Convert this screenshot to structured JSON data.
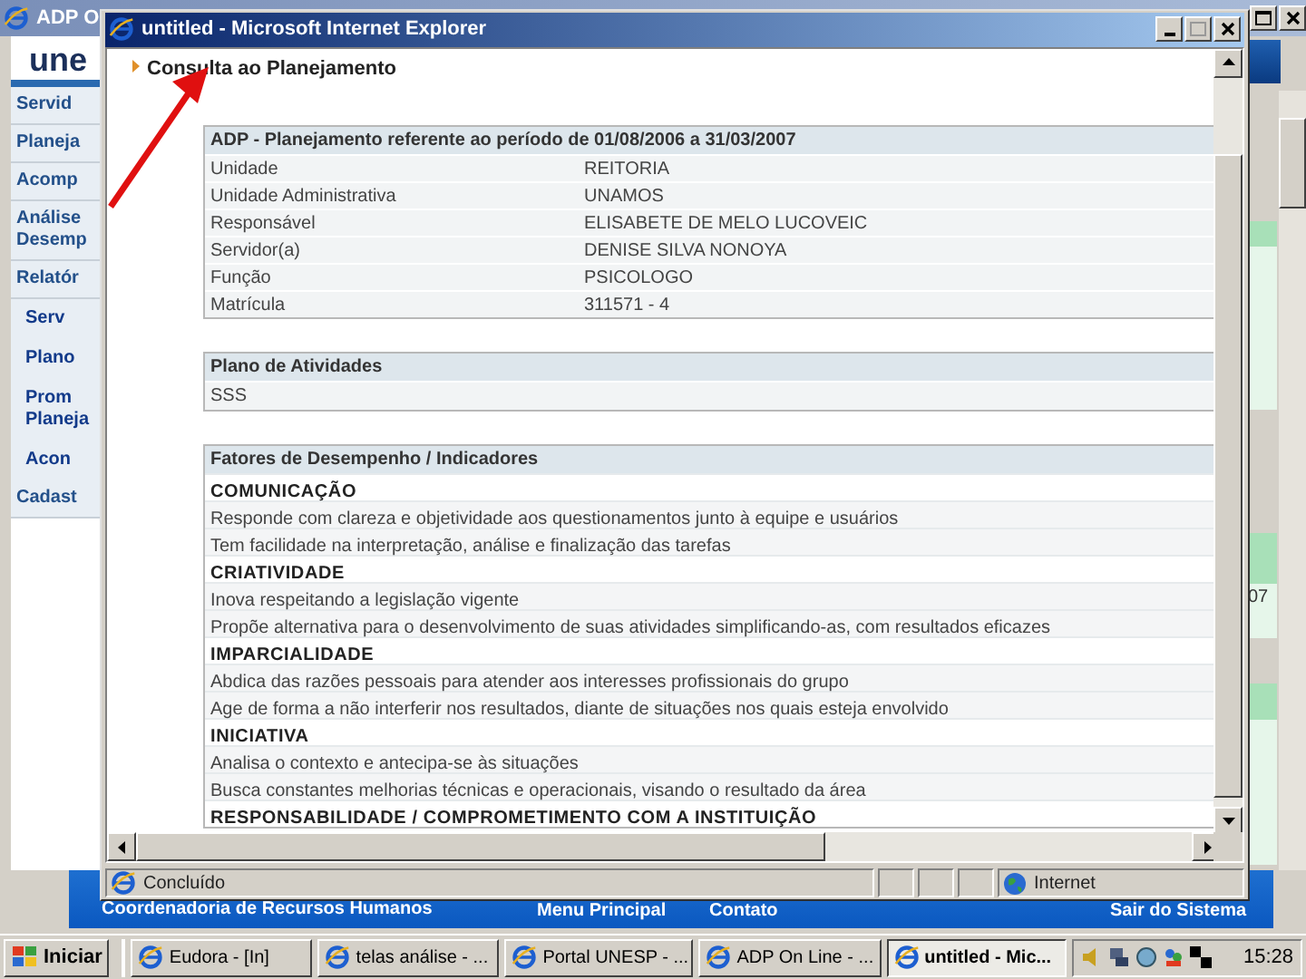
{
  "background_window": {
    "title": "ADP O",
    "logo": "une",
    "menu": [
      {
        "kind": "section",
        "label": "Servid"
      },
      {
        "kind": "section",
        "label": "Planeja"
      },
      {
        "kind": "section",
        "label": "Acomp"
      },
      {
        "kind": "section",
        "label": "Análise Desemp"
      },
      {
        "kind": "section",
        "label": "Relatór"
      },
      {
        "kind": "sub",
        "label": "Serv"
      },
      {
        "kind": "sub",
        "label": "Plano"
      },
      {
        "kind": "sub",
        "label": "Prom Planeja"
      },
      {
        "kind": "sub",
        "label": "Acon"
      },
      {
        "kind": "section",
        "label": "Cadast"
      }
    ],
    "right_fragment": "07",
    "footer": {
      "title": "Coordenadoria de Recursos Humanos",
      "links": [
        "Menu Principal",
        "Contato",
        "Sair do Sistema"
      ]
    }
  },
  "popup_window": {
    "title": "untitled - Microsoft Internet Explorer",
    "heading": "Consulta ao Planejamento",
    "info_table": {
      "header": "ADP - Planejamento referente ao período de 01/08/2006 a 31/03/2007",
      "rows": [
        [
          "Unidade",
          "REITORIA"
        ],
        [
          "Unidade Administrativa",
          "UNAMOS"
        ],
        [
          "Responsável",
          "ELISABETE DE MELO LUCOVEIC"
        ],
        [
          "Servidor(a)",
          "DENISE SILVA NONOYA"
        ],
        [
          "Função",
          "PSICOLOGO"
        ],
        [
          "Matrícula",
          "311571 - 4"
        ]
      ]
    },
    "activities_table": {
      "header": "Plano de Atividades",
      "rows": [
        "SSS"
      ]
    },
    "factors_table": {
      "header": "Fatores de Desempenho / Indicadores",
      "rows": [
        {
          "kind": "group",
          "text": "COMUNICAÇÃO"
        },
        {
          "kind": "item",
          "text": "Responde com clareza e objetividade aos questionamentos junto à equipe e usuários"
        },
        {
          "kind": "item",
          "text": "Tem facilidade na interpretação, análise e finalização das tarefas"
        },
        {
          "kind": "group",
          "text": "CRIATIVIDADE"
        },
        {
          "kind": "item",
          "text": "Inova respeitando a legislação vigente"
        },
        {
          "kind": "item",
          "text": "Propõe alternativa para o desenvolvimento de suas atividades simplificando-as, com resultados eficazes"
        },
        {
          "kind": "group",
          "text": "IMPARCIALIDADE"
        },
        {
          "kind": "item",
          "text": "Abdica das razões pessoais para atender aos interesses profissionais do grupo"
        },
        {
          "kind": "item",
          "text": "Age de forma a não interferir nos resultados, diante de situações nos quais esteja envolvido"
        },
        {
          "kind": "group",
          "text": "INICIATIVA"
        },
        {
          "kind": "item",
          "text": "Analisa o contexto e antecipa-se às situações"
        },
        {
          "kind": "item",
          "text": "Busca constantes melhorias técnicas e operacionais, visando o resultado da área"
        },
        {
          "kind": "group",
          "text": "RESPONSABILIDADE / COMPROMETIMENTO COM A INSTITUIÇÃO"
        }
      ]
    },
    "status_bar": {
      "text": "Concluído",
      "zone": "Internet"
    }
  },
  "taskbar": {
    "start": "Iniciar",
    "tasks": [
      {
        "label": "Eudora - [In]",
        "selected": false
      },
      {
        "label": "telas análise - ...",
        "selected": false
      },
      {
        "label": "Portal UNESP - ...",
        "selected": false
      },
      {
        "label": "ADP On Line - ...",
        "selected": false
      },
      {
        "label": "untitled - Mic...",
        "selected": true
      }
    ],
    "clock": "15:28"
  }
}
